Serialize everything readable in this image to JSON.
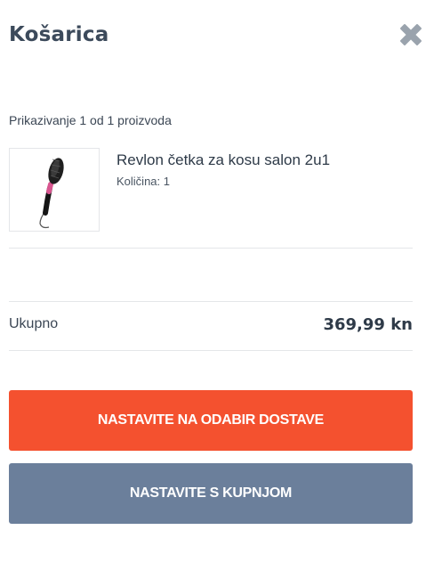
{
  "header": {
    "title": "Košarica",
    "close_icon": "close-icon"
  },
  "cart": {
    "count_text": "Prikazivanje 1 od 1 proizvoda",
    "items": [
      {
        "name": "Revlon četka za kosu salon 2u1",
        "quantity_text": "Količina: 1",
        "image_icon": "hair-dryer-brush-image"
      }
    ]
  },
  "summary": {
    "total_label": "Ukupno",
    "total_value": "369,99 kn"
  },
  "actions": {
    "primary_label": "NASTAVITE NA ODABIR DOSTAVE",
    "secondary_label": "NASTAVITE S KUPNJOM"
  },
  "colors": {
    "primary": "#f4512f",
    "secondary": "#6b7f9b",
    "close_icon": "#9aa3ad"
  }
}
